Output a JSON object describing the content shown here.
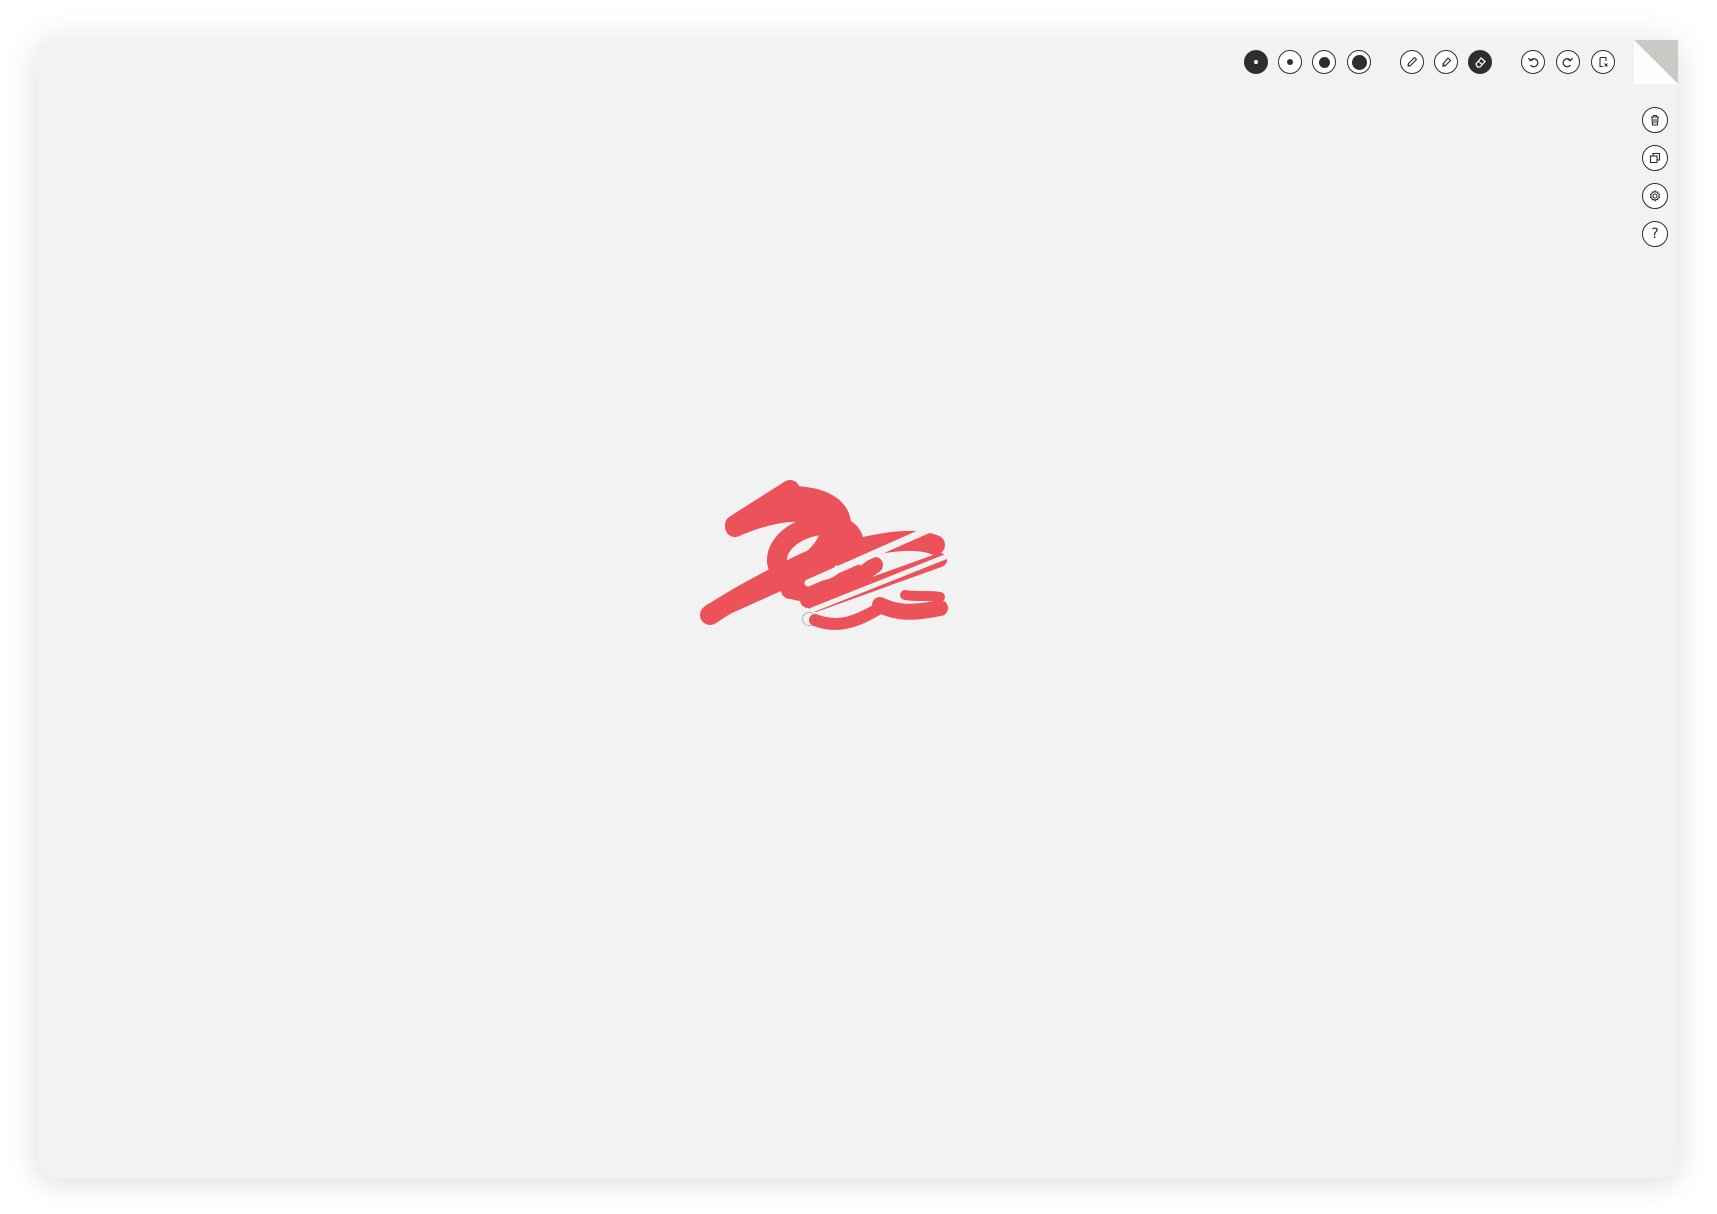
{
  "app": {
    "background_color": "#f2f2f2",
    "ink_color": "#eb525a"
  },
  "toolbar": {
    "brush_sizes": [
      {
        "name": "brush-size-1",
        "selected": true
      },
      {
        "name": "brush-size-2",
        "selected": false
      },
      {
        "name": "brush-size-3",
        "selected": false
      },
      {
        "name": "brush-size-4",
        "selected": false
      }
    ],
    "tools": [
      {
        "icon": "pencil-icon",
        "selected": false
      },
      {
        "icon": "marker-icon",
        "selected": false
      },
      {
        "icon": "eraser-icon",
        "selected": true
      }
    ],
    "history": [
      {
        "icon": "undo-icon"
      },
      {
        "icon": "redo-icon"
      },
      {
        "icon": "clear-page-icon"
      }
    ]
  },
  "side_menu": {
    "items": [
      {
        "icon": "trash-icon"
      },
      {
        "icon": "duplicate-icon"
      },
      {
        "icon": "settings-icon"
      },
      {
        "icon": "help-icon",
        "label": "?"
      }
    ]
  }
}
